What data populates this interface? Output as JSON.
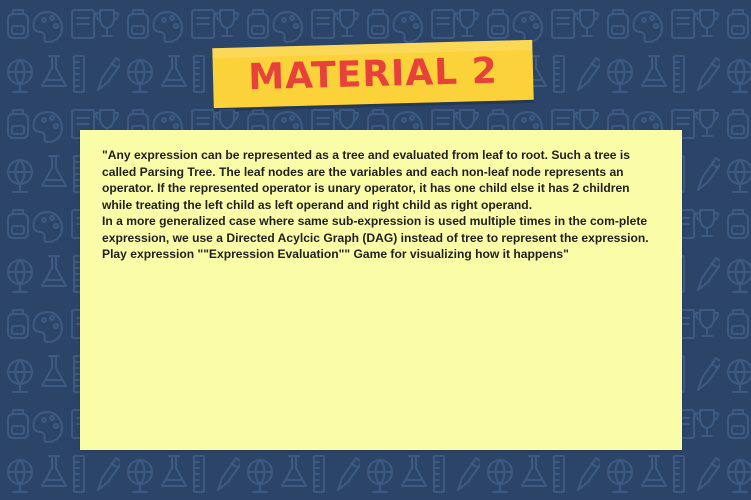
{
  "title": "MATERIAL 2",
  "content": {
    "paragraphs": [
      "\"Any expression can be represented as a tree and evaluated from leaf to root. Such a tree is called Parsing Tree. The leaf nodes are the variables and each non-leaf node represents an operator. If the represented operator is unary operator, it has one child else it has 2 children while treating the left child as left operand and right child as right operand.",
      "In a more generalized case where same sub-expression is used multiple times in the com-plete expression, we use a Directed Acylcic Graph (DAG) instead of tree to represent the expression.",
      "Play expression \"\"Expression Evaluation\"\" Game for visualizing how it happens\""
    ]
  },
  "colors": {
    "background": "#2c4468",
    "banner": "#fcd23a",
    "title": "#e8403a",
    "card": "#fbfca8"
  },
  "background_icons": [
    "backpack-icon",
    "palette-icon",
    "book-icon",
    "trophy-icon",
    "flask-icon",
    "globe-icon",
    "ruler-icon",
    "pencil-icon"
  ]
}
